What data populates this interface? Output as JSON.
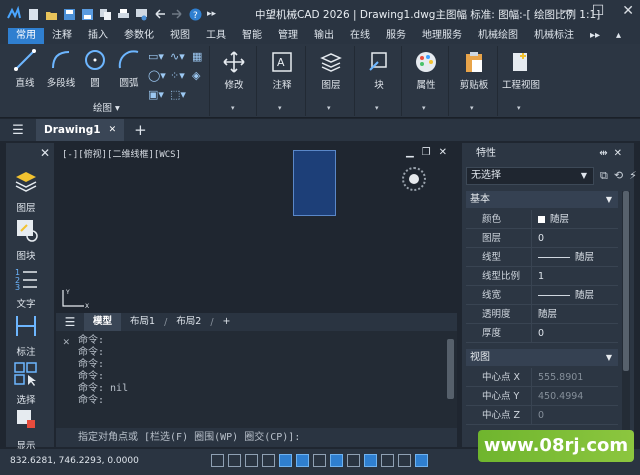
{
  "window": {
    "title": "中望机械CAD 2026 | Drawing1.dwg主图幅  标准: 图幅:-[ 绘图比例 1:1]",
    "min": "—",
    "max": "☐",
    "close": "✕"
  },
  "menu": [
    "常用",
    "注释",
    "插入",
    "参数化",
    "视图",
    "工具",
    "智能",
    "管理",
    "输出",
    "在线",
    "服务",
    "地理服务",
    "机械绘图",
    "机械标注",
    "▸▸",
    "▴"
  ],
  "ribbon": {
    "draw_buttons": [
      "直线",
      "多段线",
      "圆",
      "圆弧"
    ],
    "draw_group": "绘图 ▾",
    "modify": "修改",
    "annotate": "注释",
    "layer": "图层",
    "block": "块",
    "properties": "属性",
    "clipboard": "剪贴板",
    "engineering_view": "工程视图"
  },
  "doc_tab": {
    "name": "Drawing1",
    "close": "✕",
    "add": "+"
  },
  "left_panel": {
    "close": "✕",
    "items": [
      "图层",
      "图块",
      "文字",
      "标注",
      "选择",
      "显示"
    ]
  },
  "canvas": {
    "view_label": "[-][俯视][二维线框][WCS]",
    "ctrls": [
      "▁",
      "❐",
      "✕"
    ],
    "ucs_x": "X",
    "ucs_y": "Y"
  },
  "layout_tabs": {
    "tabs": [
      "模型",
      "布局1",
      "布局2"
    ],
    "add": "+"
  },
  "command": {
    "history": [
      "命令:",
      "命令:",
      "命令:",
      "命令:",
      "命令: nil",
      "命令:"
    ],
    "prompt": "指定对角点或 [栏选(F) 圈围(WP) 圈交(CP)]:"
  },
  "properties": {
    "title": "特性",
    "selection": "无选择",
    "sections": {
      "basic": "基本",
      "view": "视图"
    },
    "basic_rows": [
      {
        "k": "颜色",
        "v": "随层",
        "kind": "swatch"
      },
      {
        "k": "图层",
        "v": "0"
      },
      {
        "k": "线型",
        "v": "随层",
        "kind": "line"
      },
      {
        "k": "线型比例",
        "v": "1"
      },
      {
        "k": "线宽",
        "v": "随层",
        "kind": "line"
      },
      {
        "k": "透明度",
        "v": "随层"
      },
      {
        "k": "厚度",
        "v": "0"
      }
    ],
    "view_rows": [
      {
        "k": "中心点 X",
        "v": "555.8901",
        "dim": true
      },
      {
        "k": "中心点 Y",
        "v": "450.4994",
        "dim": true
      },
      {
        "k": "中心点 Z",
        "v": "0",
        "dim": true
      }
    ]
  },
  "status": {
    "coords": "832.6281, 746.2293, 0.0000"
  },
  "watermark": "www.08rj.com"
}
